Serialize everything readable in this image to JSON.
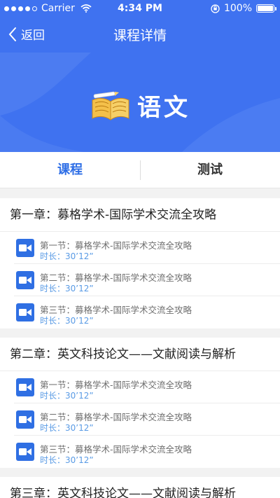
{
  "status_bar": {
    "carrier": "Carrier",
    "time": "4:34 PM",
    "battery": "100%"
  },
  "nav": {
    "back_label": "返回",
    "title": "课程详情"
  },
  "banner": {
    "subject": "语文"
  },
  "tabs": [
    {
      "label": "课程",
      "active": true
    },
    {
      "label": "测试",
      "active": false
    }
  ],
  "chapters": [
    {
      "title": "第一章：募格学术-国际学术交流全攻略",
      "lessons": [
        {
          "name": "第一节：募格学术-国际学术交流全攻略",
          "duration": "时长：30’12”"
        },
        {
          "name": "第二节：募格学术-国际学术交流全攻略",
          "duration": "时长：30’12”"
        },
        {
          "name": "第三节：募格学术-国际学术交流全攻略",
          "duration": "时长：30’12”"
        }
      ]
    },
    {
      "title": "第二章：英文科技论文——文献阅读与解析",
      "lessons": [
        {
          "name": "第一节：募格学术-国际学术交流全攻略",
          "duration": "时长：30’12”"
        },
        {
          "name": "第二节：募格学术-国际学术交流全攻略",
          "duration": "时长：30’12”"
        },
        {
          "name": "第三节：募格学术-国际学术交流全攻略",
          "duration": "时长：30’12”"
        }
      ]
    },
    {
      "title": "第三章：英文科技论文——文献阅读与解析",
      "lessons": []
    }
  ],
  "colors": {
    "header_bg": "#3f72f0",
    "active_tab": "#2e6ee6",
    "duration_text": "#5a9be5",
    "play_icon_bg": "#2f6fe3"
  }
}
